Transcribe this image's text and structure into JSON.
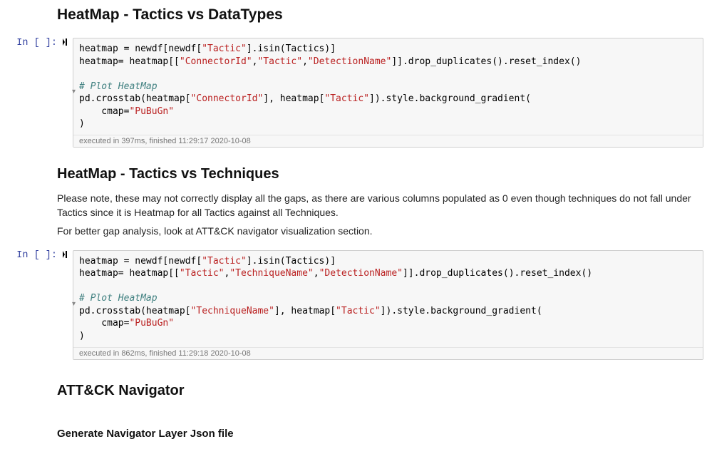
{
  "section1": {
    "heading": "HeatMap - Tactics vs DataTypes"
  },
  "cell1": {
    "prompt": "In [ ]:",
    "code_html": "heatmap = newdf[newdf[<span class=\"tok-str\">\"Tactic\"</span>].isin(Tactics)]\nheatmap= heatmap[[<span class=\"tok-str\">\"ConnectorId\"</span>,<span class=\"tok-str\">\"Tactic\"</span>,<span class=\"tok-str\">\"DetectionName\"</span>]].drop_duplicates().reset_index()\n\n<span class=\"tok-cmt\"># Plot HeatMap</span>\npd.crosstab(heatmap[<span class=\"tok-str\">\"ConnectorId\"</span>], heatmap[<span class=\"tok-str\">\"Tactic\"</span>]).style.background_gradient(\n    cmap=<span class=\"tok-str\">\"PuBuGn\"</span>\n)",
    "exec": "executed in 397ms, finished 11:29:17 2020-10-08"
  },
  "section2": {
    "heading": "HeatMap - Tactics vs Techniques",
    "p1": "Please note, these may not correctly display all the gaps, as there are various columns populated as 0 even though techniques do not fall under Tactics since it is Heatmap for all Tactics against all Techniques.",
    "p2": "For better gap analysis, look at ATT&CK navigator visualization section."
  },
  "cell2": {
    "prompt": "In [ ]:",
    "code_html": "heatmap = newdf[newdf[<span class=\"tok-str\">\"Tactic\"</span>].isin(Tactics)]\nheatmap= heatmap[[<span class=\"tok-str\">\"Tactic\"</span>,<span class=\"tok-str\">\"TechniqueName\"</span>,<span class=\"tok-str\">\"DetectionName\"</span>]].drop_duplicates().reset_index()\n\n<span class=\"tok-cmt\"># Plot HeatMap</span>\npd.crosstab(heatmap[<span class=\"tok-str\">\"TechniqueName\"</span>], heatmap[<span class=\"tok-str\">\"Tactic\"</span>]).style.background_gradient(\n    cmap=<span class=\"tok-str\">\"PuBuGn\"</span>\n)",
    "exec": "executed in 862ms, finished 11:29:18 2020-10-08"
  },
  "section3": {
    "heading": "ATT&CK Navigator"
  },
  "section4": {
    "heading": "Generate Navigator Layer Json file"
  }
}
